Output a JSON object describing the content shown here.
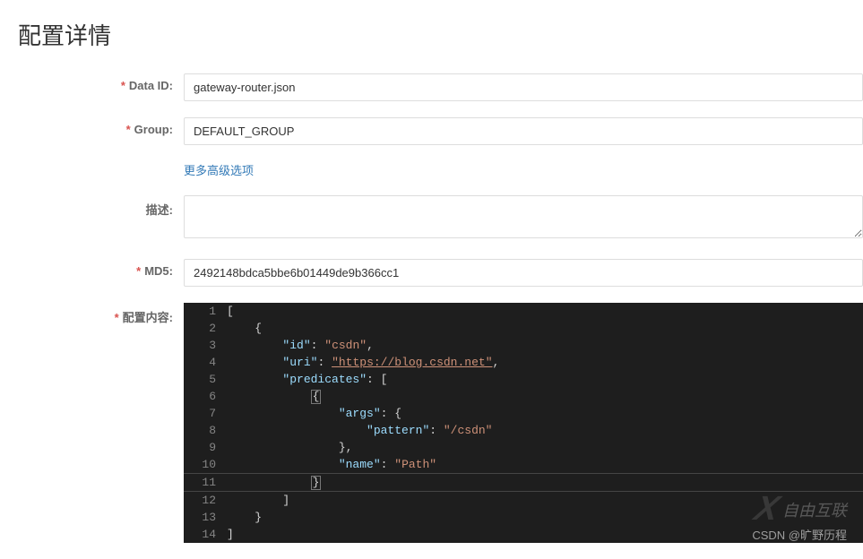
{
  "page": {
    "title": "配置详情"
  },
  "labels": {
    "dataId": "Data ID:",
    "group": "Group:",
    "advanced": "更多高级选项",
    "description": "描述:",
    "md5": "MD5:",
    "content": "配置内容:"
  },
  "fields": {
    "dataId": "gateway-router.json",
    "group": "DEFAULT_GROUP",
    "description": "",
    "md5": "2492148bdca5bbe6b01449de9b366cc1"
  },
  "code": {
    "json_value": {
      "id": "csdn",
      "uri": "https://blog.csdn.net",
      "predicates_args_pattern": "/csdn",
      "predicates_name": "Path"
    },
    "lines": [
      "[",
      "    {",
      "        \"id\": \"csdn\",",
      "        \"uri\": \"https://blog.csdn.net\",",
      "        \"predicates\": [",
      "            {",
      "                \"args\": {",
      "                    \"pattern\": \"/csdn\"",
      "                },",
      "                \"name\": \"Path\"",
      "            }",
      "        ]",
      "    }",
      "]"
    ]
  },
  "watermark": {
    "brand": "自由互联",
    "csdn": "CSDN @旷野历程"
  }
}
